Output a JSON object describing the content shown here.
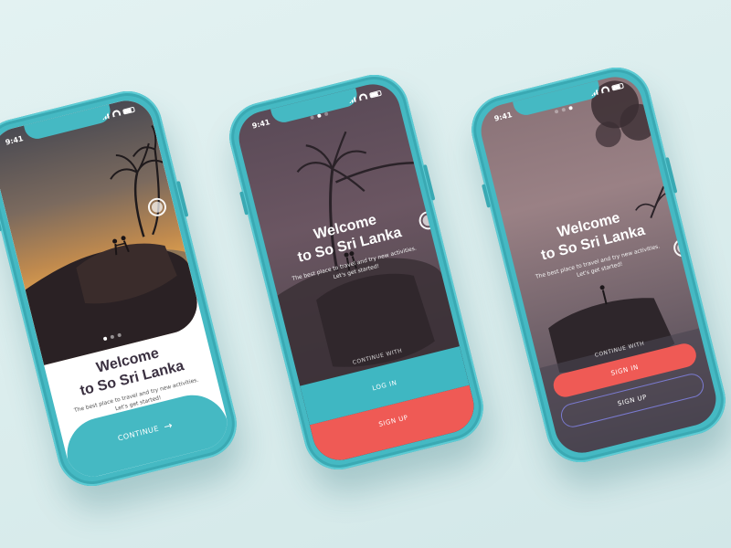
{
  "status": {
    "time": "9:41"
  },
  "app": {
    "title_line1": "Welcome",
    "title_line2": "to So Sri Lanka",
    "subtitle": "The best place to travel and try new activities. Let's get started!"
  },
  "screen1": {
    "continue_label": "CONTINUE",
    "arrow": "→"
  },
  "screen2": {
    "continue_with": "CONTINUE WITH",
    "login_label": "LOG IN",
    "signup_label": "SIGN UP"
  },
  "screen3": {
    "continue_with": "CONTINUE WITH",
    "signin_label": "SIGN IN",
    "signup_label": "SIGN UP"
  },
  "colors": {
    "device": "#45b9c3",
    "accent_teal": "#3fb7c2",
    "accent_red": "#ef5a55"
  },
  "icons": [
    "sun-icon",
    "palm-tree-icon",
    "arrow-right-icon",
    "signal-icon",
    "wifi-icon",
    "battery-icon"
  ]
}
